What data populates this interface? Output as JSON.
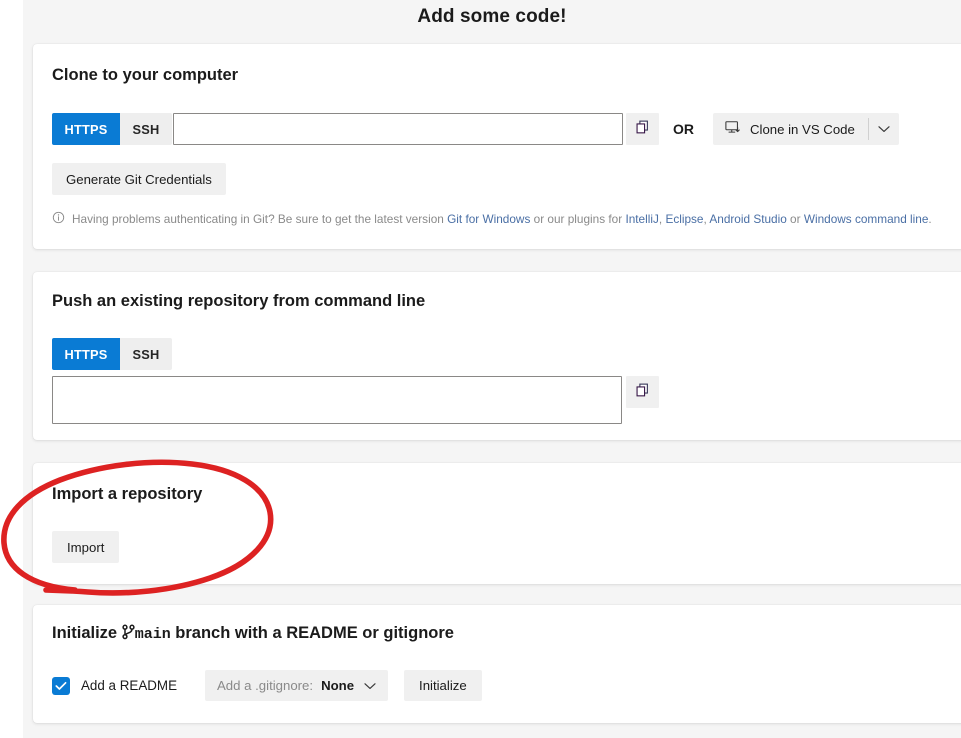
{
  "page": {
    "title": "Add some code!"
  },
  "clone": {
    "heading": "Clone to your computer",
    "tabs": [
      {
        "label": "HTTPS",
        "active": true
      },
      {
        "label": "SSH",
        "active": false
      }
    ],
    "url_value": "",
    "url_placeholder": "",
    "copy_icon": "copy-icon",
    "or_label": "OR",
    "vscode_button": "Clone in VS Code",
    "vscode_icon": "monitor-download-icon",
    "caret_icon": "chevron-down-icon",
    "generate_credentials": "Generate Git Credentials",
    "info_icon": "info-circle-icon",
    "info": {
      "part1": "Having problems authenticating in Git? Be sure to get the latest version ",
      "link1": "Git for Windows",
      "part2": " or our plugins for ",
      "link2": "IntelliJ",
      "sep1": ", ",
      "link3": "Eclipse",
      "sep2": ", ",
      "link4": "Android Studio",
      "part3": " or ",
      "link5": "Windows command line",
      "part4": "."
    }
  },
  "push": {
    "heading": "Push an existing repository from command line",
    "tabs": [
      {
        "label": "HTTPS",
        "active": true
      },
      {
        "label": "SSH",
        "active": false
      }
    ],
    "command_value": "",
    "command_placeholder": "",
    "copy_icon": "copy-icon"
  },
  "import": {
    "heading": "Import a repository",
    "button": "Import"
  },
  "initialize": {
    "heading_prefix": "Initialize ",
    "branch_icon": "git-branch-icon",
    "branch_name": "main",
    "heading_suffix": " branch with a README or gitignore",
    "readme_checkbox_label": "Add a README",
    "readme_checked": true,
    "gitignore_prefix": "Add a .gitignore:",
    "gitignore_value": "None",
    "gitignore_caret": "chevron-down-icon",
    "initialize_button": "Initialize"
  },
  "annotation": {
    "type": "hand-drawn-ellipse",
    "color": "#dd2222",
    "target": "import-section"
  },
  "colors": {
    "accent": "#0a7bd4",
    "page_bg": "#f5f5f5",
    "card_bg": "#ffffff",
    "button_bg": "#f0f0f0",
    "link": "#4a6fa5",
    "muted_text": "#8a8a8a",
    "annotation_red": "#dd2222"
  }
}
